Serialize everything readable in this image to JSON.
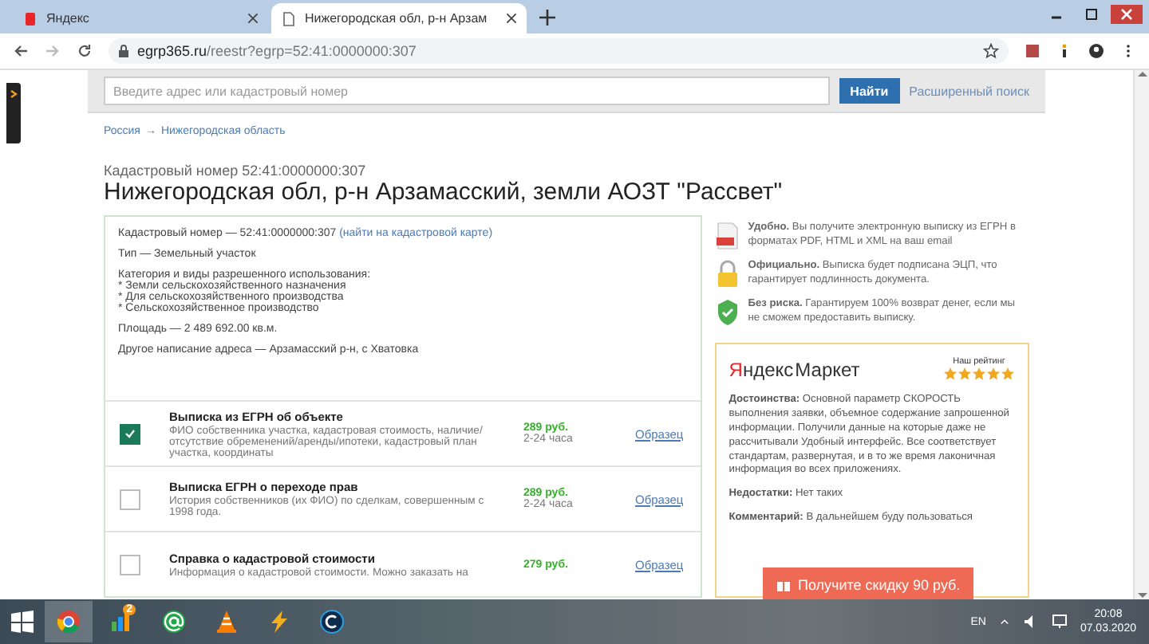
{
  "browser": {
    "tabs": [
      {
        "kind": "yandex",
        "title": "Яндекс",
        "selected": false
      },
      {
        "kind": "page",
        "title": "Нижегородская обл, р-н Арзам",
        "selected": true
      }
    ],
    "url_host": "egrp365.ru",
    "url_path": "/reestr?egrp=52:41:0000000:307"
  },
  "search": {
    "placeholder": "Введите адрес или кадастровый номер",
    "button": "Найти",
    "advanced": "Расширенный поиск"
  },
  "breadcrumb": {
    "items": [
      "Россия",
      "Нижегородская область"
    ],
    "separator": "→"
  },
  "cadastral_label": "Кадастровый номер 52:41:0000000:307",
  "title": "Нижегородская обл, р-н Арзамасский, земли АОЗТ \"Рассвет\"",
  "details": {
    "number": "Кадастровый номер — 52:41:0000000:307",
    "map_link": "(найти на кадастровой карте)",
    "type": "Тип — Земельный участок",
    "category_heading": "Категория и виды разрешенного использования:",
    "categories": [
      "* Земли сельскохозяйственного назначения",
      "* Для сельскохозяйственного производства",
      "* Сельскохозяйственное производство"
    ],
    "area": "Площадь — 2 489 692.00 кв.м.",
    "alt_address": "Другое написание адреса — Арзамасский р-н, с Хватовка"
  },
  "products": [
    {
      "name": "Выписка из ЕГРН об объекте",
      "description": "ФИО собственника участка, кадастровая стоимость, наличие/отсутствие обременений/аренды/ипотеки, кадастровый план участка, координаты",
      "price": "289 руб.",
      "term": "2-24 часа",
      "sample": "Образец",
      "checked": true
    },
    {
      "name": "Выписка ЕГРН о переходе прав",
      "description": "История собственников (их ФИО) по сделкам, совершенным с 1998 года.",
      "price": "289 руб.",
      "term": "2-24 часа",
      "sample": "Образец",
      "checked": false
    },
    {
      "name": "Справка о кадастровой стоимости",
      "description": "Информация о кадастровой стоимости. Можно заказать на",
      "price": "279 руб.",
      "sample": "Образец",
      "checked": false
    }
  ],
  "benefits": [
    {
      "kind": "pdf",
      "text": "**Удобно.** Вы получите электронную выписку из ЕГРН в форматах PDF, HTML и XML на ваш email"
    },
    {
      "kind": "lock",
      "text": "**Официально.** Выписка будет подписана ЭЦП, что гарантирует подлинность документа."
    },
    {
      "kind": "shield",
      "text": "**Без риска.** Гарантируем 100% возврат денег, если мы не сможем предоставить выписку."
    }
  ],
  "review": {
    "brand": [
      "Яндекс",
      "Маркет"
    ],
    "rating_label": "Наш рейтинг",
    "stars": 5,
    "paragraphs": [
      "**Достоинства:** Основной параметр СКОРОСТЬ выполнения заявки, объемное содержание запрошенной информации. Получили данные на которые даже не рассчитывали Удобный интерфейс. Все соответствует стандартам, развернутая, и в то же время лаконичная информация во всех приложениях.",
      "**Недостатки:** Нет таких",
      "**Комментарий:** В дальнейшем буду пользоваться"
    ]
  },
  "promo": "Получите скидку 90 руб.",
  "taskbar": {
    "apps": [
      {
        "kind": "chrome",
        "active": true
      },
      {
        "kind": "chart",
        "active": false,
        "badge": "2"
      },
      {
        "kind": "mail",
        "active": false
      },
      {
        "kind": "cone",
        "active": false
      },
      {
        "kind": "bolt",
        "active": false
      },
      {
        "kind": "cleaner",
        "active": false
      }
    ],
    "language": "EN",
    "time": "20:08",
    "date": "07.03.2020"
  }
}
